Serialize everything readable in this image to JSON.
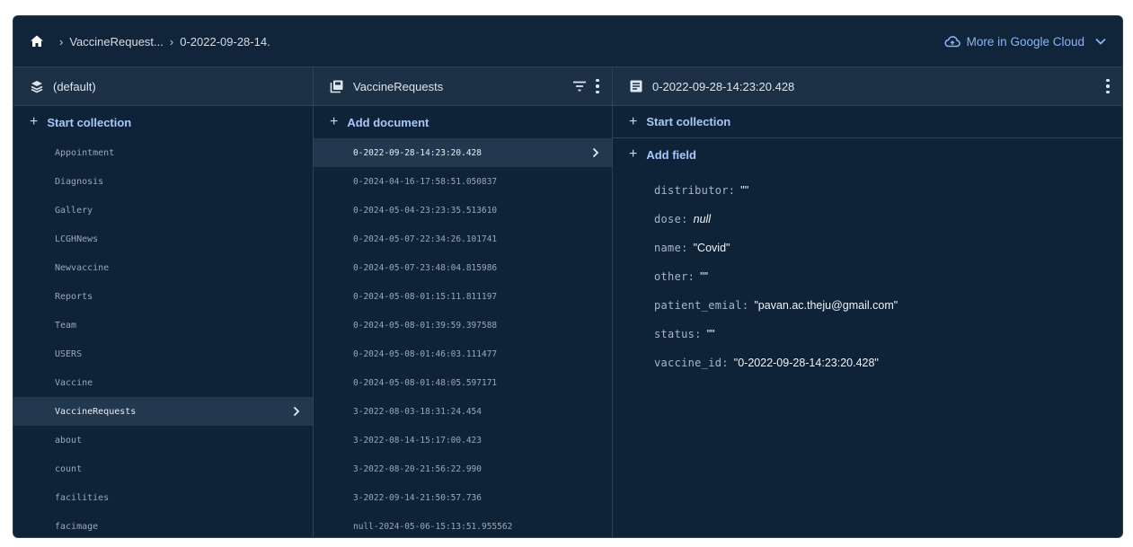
{
  "breadcrumb": {
    "items": [
      "VaccineRequest...",
      "0-2022-09-28-14."
    ]
  },
  "header": {
    "cloud_label": "More in Google Cloud"
  },
  "col1": {
    "title": "(default)",
    "action": "Start collection",
    "items": [
      "Appointment",
      "Diagnosis",
      "Gallery",
      "LCGHNews",
      "Newvaccine",
      "Reports",
      "Team",
      "USERS",
      "Vaccine",
      "VaccineRequests",
      "about",
      "count",
      "facilities",
      "facimage"
    ],
    "selected_index": 9
  },
  "col2": {
    "title": "VaccineRequests",
    "action": "Add document",
    "items": [
      "0-2022-09-28-14:23:20.428",
      "0-2024-04-16-17:58:51.050837",
      "0-2024-05-04-23:23:35.513610",
      "0-2024-05-07-22:34:26.101741",
      "0-2024-05-07-23:48:04.815986",
      "0-2024-05-08-01:15:11.811197",
      "0-2024-05-08-01:39:59.397588",
      "0-2024-05-08-01:46:03.111477",
      "0-2024-05-08-01:48:05.597171",
      "3-2022-08-03-18:31:24.454",
      "3-2022-08-14-15:17:00.423",
      "3-2022-08-20-21:56:22.990",
      "3-2022-09-14-21:50:57.736",
      "null-2024-05-06-15:13:51.955562"
    ],
    "selected_index": 0
  },
  "col3": {
    "title": "0-2022-09-28-14:23:20.428",
    "action_collection": "Start collection",
    "action_field": "Add field",
    "fields": [
      {
        "key": "distributor:",
        "value": "\"\""
      },
      {
        "key": "dose:",
        "value": "null"
      },
      {
        "key": "name:",
        "value": "\"Covid\""
      },
      {
        "key": "other:",
        "value": "\"\""
      },
      {
        "key": "patient_emial:",
        "value": "\"pavan.ac.theju@gmail.com\""
      },
      {
        "key": "status:",
        "value": "\"\""
      },
      {
        "key": "vaccine_id:",
        "value": "\"0-2022-09-28-14:23:20.428\""
      }
    ]
  },
  "colors": {
    "background": "#0f2338",
    "header_bg": "#1c3046",
    "accent": "#a8c7fa",
    "link": "#8ab4f8",
    "selected_row": "#22384f"
  },
  "icons": {
    "home": "home-icon",
    "db": "database-icon",
    "collection": "collection-icon",
    "document": "document-icon",
    "filter": "filter-icon",
    "cloud": "cloud-icon"
  }
}
